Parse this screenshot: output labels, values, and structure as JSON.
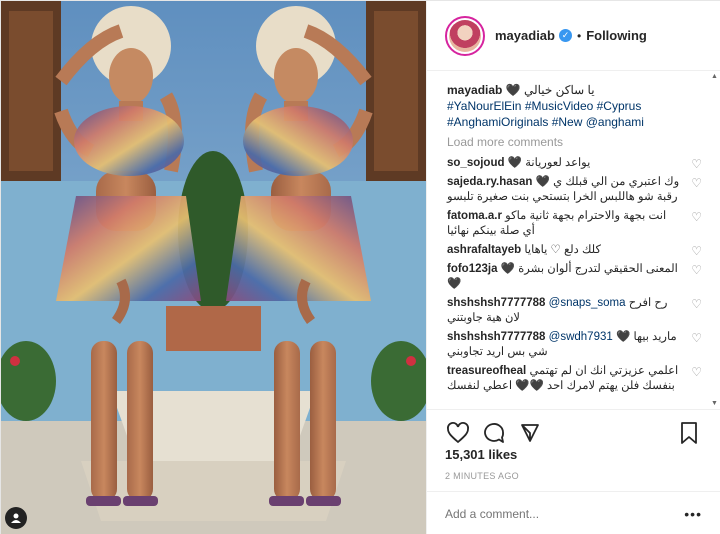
{
  "post": {
    "username": "mayadiab",
    "follow_status": "Following",
    "separator": "•",
    "caption_text": "يا ساكن خيالي 🖤",
    "caption_tags": "#YaNourElEin #MusicVideo #Cyprus #AnghamiOriginals #New @anghami",
    "load_more": "Load more comments",
    "likes": "15,301 likes",
    "time_ago": "2 MINUTES AGO",
    "add_comment_placeholder": "Add a comment...",
    "more_glyph": "•••"
  },
  "comments": [
    {
      "user": "so_sojoud",
      "text": "يواعد لعوريانة 🖤",
      "mention": ""
    },
    {
      "user": "sajeda.ry.hasan",
      "text": "وك اعتبري من الي قبلك ي 🖤رقبة شو هاللبس الخرا بتستحي بنت صغيرة تلبسو",
      "mention": ""
    },
    {
      "user": "fatoma.a.r",
      "text": "انت بجهة والاحترام بجهة ثانية ماكو أي صلة بينكم نهائيا",
      "mention": ""
    },
    {
      "user": "ashrafaltayeb",
      "text": "كلك دلع ♡ ياهايا",
      "mention": ""
    },
    {
      "user": "fofo123ja",
      "text": "المعنى الحقيقي لتدرج ألوان بشرة 🖤🖤",
      "mention": ""
    },
    {
      "user": "shshshsh7777788",
      "text": "رح افرح لان هية جاوبتني",
      "mention": "@snaps_soma"
    },
    {
      "user": "shshshsh7777788",
      "text": "ماريد بيها 🖤شي بس اريد تجاوبني",
      "mention": "@swdh7931"
    },
    {
      "user": "treasureofheal",
      "text": "اعلمي عزيزتي انك ان لم تهتمي بنفسك فلن يهتم لامرك احد 🖤🖤 اعطي لنفسك",
      "mention": ""
    }
  ],
  "icons": {
    "like": "heart-icon",
    "comment": "comment-icon",
    "share": "share-icon",
    "save": "bookmark-icon",
    "verified": "verified-badge-icon",
    "comment_like": "small-heart-icon",
    "user_tag": "user-tag-icon"
  },
  "colors": {
    "link": "#003569",
    "verified": "#3897f0",
    "muted": "#999999",
    "text": "#262626",
    "story_ring": "#d6249f"
  }
}
